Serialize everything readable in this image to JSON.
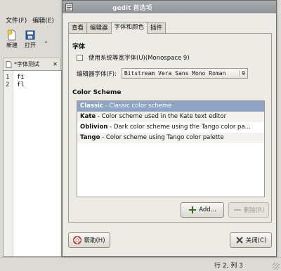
{
  "background_window": {
    "menu": [
      "文件(F)",
      "编辑(E)"
    ],
    "toolbar": {
      "new_label": "新建",
      "open_label": "打开",
      "dropdown_glyph": "⌄"
    },
    "document_tab": {
      "label": "*字体测试",
      "close_glyph": "✕"
    },
    "editor_lines": [
      {
        "num": "1",
        "text": "fi"
      },
      {
        "num": "2",
        "text": "fl"
      }
    ],
    "status": {
      "position": "行 2, 列 3"
    }
  },
  "dialog": {
    "title": "gedit 首选项",
    "tabs": [
      {
        "label": "查看",
        "active": false
      },
      {
        "label": "编辑器",
        "active": false
      },
      {
        "label": "字体和颜色",
        "active": true
      },
      {
        "label": "插件",
        "active": false
      }
    ],
    "font_section": {
      "title": "字体",
      "system_font_checkbox": {
        "label": "使用系统等宽字体(U)(Monospace 9)",
        "checked": false
      },
      "editor_font_label": "编辑器字体(F):",
      "editor_font_name": "Bitstream Vera Sans Mono Roman",
      "editor_font_size": "9"
    },
    "color_scheme": {
      "title": "Color Scheme",
      "schemes": [
        {
          "name": "Classic",
          "description": " - Classic color scheme",
          "selected": true
        },
        {
          "name": "Kate",
          "description": " - Color scheme used in the Kate text editor",
          "selected": false
        },
        {
          "name": "Oblivion",
          "description": " - Dark color scheme using the Tango color pa...",
          "selected": false
        },
        {
          "name": "Tango",
          "description": " - Color scheme using Tango color palette",
          "selected": false
        }
      ],
      "add_button": "Add...",
      "remove_button": "删除(R)"
    },
    "help_button": "帮助(H)",
    "close_button": "关闭(C)"
  },
  "colors": {
    "selection": "#8ea4c4",
    "dialog_bg": "#edebe6",
    "titlebar": "#9a9da2"
  }
}
